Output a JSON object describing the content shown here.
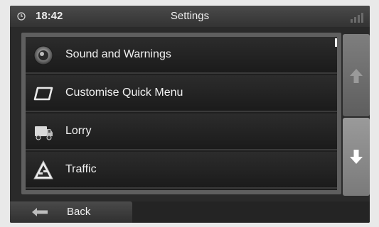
{
  "statusbar": {
    "time": "18:42",
    "title": "Settings",
    "clock_icon": "clock-icon",
    "signal_icon": "signal-bars-icon"
  },
  "menu": {
    "items": [
      {
        "label": "Sound and Warnings",
        "icon": "speaker-icon"
      },
      {
        "label": "Customise Quick Menu",
        "icon": "quick-menu-icon"
      },
      {
        "label": "Lorry",
        "icon": "lorry-icon"
      },
      {
        "label": "Traffic",
        "icon": "traffic-warning-icon"
      }
    ]
  },
  "scroll": {
    "up_icon": "arrow-up-icon",
    "down_icon": "arrow-down-icon"
  },
  "footer": {
    "back_label": "Back",
    "back_icon": "back-arrow-icon"
  }
}
